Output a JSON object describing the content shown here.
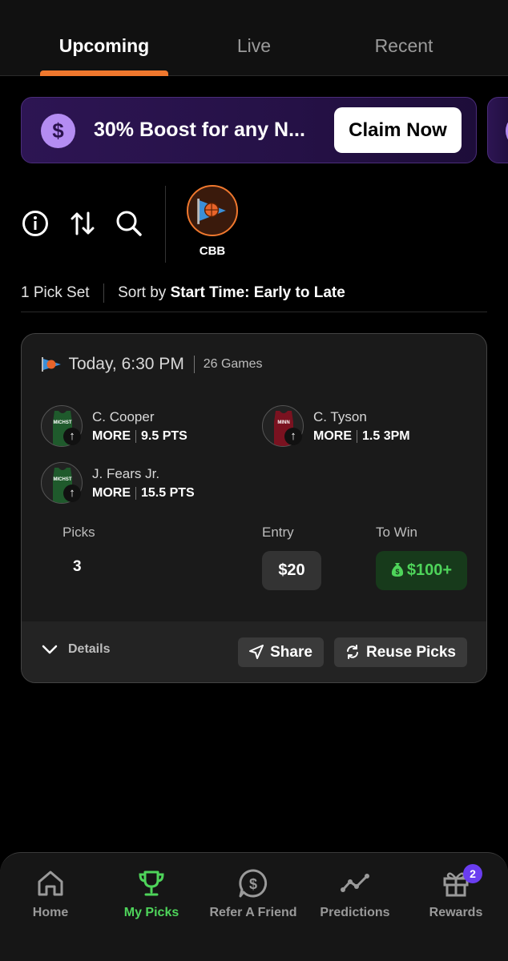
{
  "tabs": [
    {
      "label": "Upcoming",
      "active": true
    },
    {
      "label": "Live",
      "active": false
    },
    {
      "label": "Recent",
      "active": false
    }
  ],
  "promo": {
    "icon": "dollar-icon",
    "text": "30% Boost for any N...",
    "button": "Claim Now"
  },
  "toolbar": {
    "icons": [
      "info-icon",
      "sort-icon",
      "search-icon"
    ],
    "sport_filter": {
      "label": "CBB",
      "icon": "basketball-flag-icon"
    }
  },
  "sortbar": {
    "count": "1 Pick Set",
    "sort_prefix": "Sort by",
    "sort_value": "Start Time: Early to Late"
  },
  "card": {
    "time": "Today, 6:30 PM",
    "games": "26 Games",
    "picks": [
      {
        "name": "C. Cooper",
        "direction": "MORE",
        "line": "9.5 PTS",
        "team": "MICHST",
        "jersey_color": "#1f5a2c"
      },
      {
        "name": "C. Tyson",
        "direction": "MORE",
        "line": "1.5 3PM",
        "team": "MINN",
        "jersey_color": "#7a1220"
      },
      {
        "name": "J. Fears Jr.",
        "direction": "MORE",
        "line": "15.5 PTS",
        "team": "MICHST",
        "jersey_color": "#1f5a2c"
      }
    ],
    "stats": {
      "picks_label": "Picks",
      "picks_value": "3",
      "entry_label": "Entry",
      "entry_value": "$20",
      "win_label": "To Win",
      "win_value": "$100+"
    },
    "footer": {
      "details": "Details",
      "share": "Share",
      "reuse": "Reuse Picks"
    }
  },
  "nav": [
    {
      "label": "Home",
      "icon": "home-icon",
      "active": false
    },
    {
      "label": "My Picks",
      "icon": "trophy-icon",
      "active": true
    },
    {
      "label": "Refer A Friend",
      "icon": "dollar-chat-icon",
      "active": false
    },
    {
      "label": "Predictions",
      "icon": "trend-line-icon",
      "active": false
    },
    {
      "label": "Rewards",
      "icon": "gift-icon",
      "active": false,
      "badge": "2"
    }
  ],
  "colors": {
    "accent_orange": "#f0782e",
    "accent_green": "#4ed45a",
    "promo_purple": "#2d1553",
    "badge_purple": "#6a3df0"
  }
}
